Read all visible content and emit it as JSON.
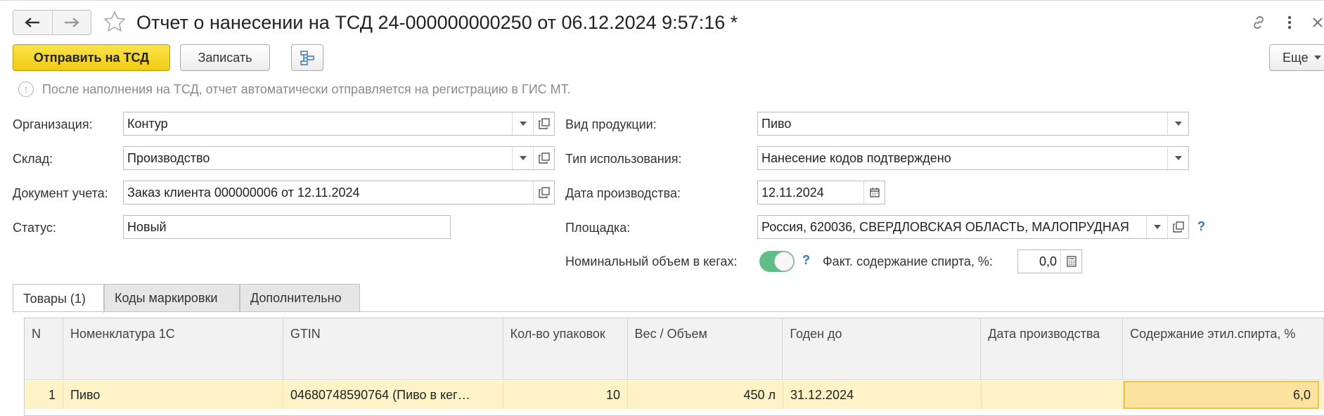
{
  "header": {
    "title": "Отчет о нанесении на ТСД 24-000000000250 от 06.12.2024 9:57:16 *"
  },
  "toolbar": {
    "send_label": "Отправить на ТСД",
    "save_label": "Записать",
    "more_label": "Еще"
  },
  "info": "После наполнения на ТСД, отчет автоматически отправляется на регистрацию в ГИС МТ.",
  "form": {
    "org_label": "Организация:",
    "org_value": "Контур",
    "warehouse_label": "Склад:",
    "warehouse_value": "Производство",
    "doc_label": "Документ учета:",
    "doc_value": "Заказ клиента 000000006 от 12.11.2024",
    "status_label": "Статус:",
    "status_value": "Новый",
    "product_kind_label": "Вид продукции:",
    "product_kind_value": "Пиво",
    "usage_type_label": "Тип использования:",
    "usage_type_value": "Нанесение кодов подтверждено",
    "prod_date_label": "Дата производства:",
    "prod_date_value": "12.11.2024",
    "site_label": "Площадка:",
    "site_value": "Россия, 620036, СВЕРДЛОВСКАЯ ОБЛАСТЬ, МАЛОПРУДНАЯ",
    "kegs_label": "Номинальный объем в кегах:",
    "kegs_on": true,
    "alcohol_label": "Факт. содержание спирта, %:",
    "alcohol_value": "0,0",
    "help": "?"
  },
  "tabs": [
    {
      "label": "Товары (1)",
      "active": true
    },
    {
      "label": "Коды маркировки",
      "active": false
    },
    {
      "label": "Дополнительно",
      "active": false
    }
  ],
  "table": {
    "columns": [
      "N",
      "Номенклатура 1С",
      "GTIN",
      "Кол-во упаковок",
      "Вес / Объем",
      "Годен до",
      "Дата производства",
      "Содержание этил.спирта, %"
    ],
    "rows": [
      [
        "1",
        "Пиво",
        "04680748590764 (Пиво в кег…",
        "10",
        "450 л",
        "31.12.2024",
        "",
        "6,0"
      ]
    ]
  },
  "colors": {
    "primary_button": "#f5d11f",
    "toggle_on": "#5fbd8a",
    "selected_row": "#fdf3c7",
    "help": "#2a7ab8"
  },
  "icons": {
    "back": "arrow-left-icon",
    "forward": "arrow-right-icon",
    "favorite": "star-icon",
    "link": "link-icon",
    "menu": "more-vert-icon",
    "close": "close-icon",
    "structure": "structure-icon",
    "dropdown": "chevron-down-icon",
    "open": "open-window-icon",
    "calendar": "calendar-icon",
    "calculator": "calculator-icon",
    "info": "info-icon"
  }
}
